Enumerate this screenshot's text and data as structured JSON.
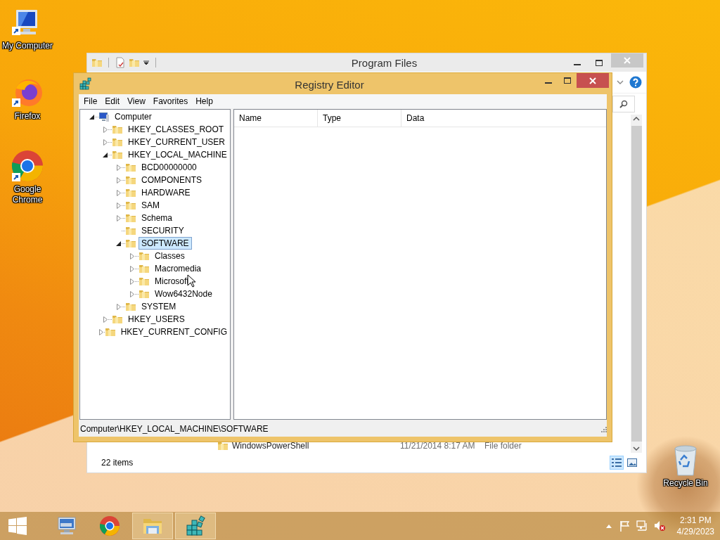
{
  "desktop_icons": [
    {
      "kind": "computer",
      "label": "My Computer"
    },
    {
      "kind": "firefox",
      "label": "Firefox"
    },
    {
      "kind": "chrome",
      "label": "Google Chrome"
    },
    {
      "kind": "recycle-bin",
      "label": "Recycle Bin"
    }
  ],
  "explorer": {
    "title": "Program Files",
    "rows": [
      {
        "name": "WindowsPowerShell",
        "date_modified": "11/21/2014 8:17 AM",
        "type": "File folder"
      }
    ],
    "status": "22 items"
  },
  "registry_editor": {
    "title": "Registry Editor",
    "menu": [
      "File",
      "Edit",
      "View",
      "Favorites",
      "Help"
    ],
    "tree": [
      {
        "label": "Computer",
        "kind": "computer",
        "expandable": true,
        "expanded": true,
        "selected": false,
        "children": [
          {
            "label": "HKEY_CLASSES_ROOT",
            "kind": "folder",
            "expandable": true,
            "expanded": false,
            "selected": false
          },
          {
            "label": "HKEY_CURRENT_USER",
            "kind": "folder",
            "expandable": true,
            "expanded": false,
            "selected": false
          },
          {
            "label": "HKEY_LOCAL_MACHINE",
            "kind": "folder",
            "expandable": true,
            "expanded": true,
            "selected": false,
            "children": [
              {
                "label": "BCD00000000",
                "kind": "folder",
                "expandable": true,
                "expanded": false,
                "selected": false
              },
              {
                "label": "COMPONENTS",
                "kind": "folder",
                "expandable": true,
                "expanded": false,
                "selected": false
              },
              {
                "label": "HARDWARE",
                "kind": "folder",
                "expandable": true,
                "expanded": false,
                "selected": false
              },
              {
                "label": "SAM",
                "kind": "folder",
                "expandable": true,
                "expanded": false,
                "selected": false
              },
              {
                "label": "Schema",
                "kind": "folder",
                "expandable": true,
                "expanded": false,
                "selected": false
              },
              {
                "label": "SECURITY",
                "kind": "folder",
                "expandable": false,
                "expanded": false,
                "selected": false
              },
              {
                "label": "SOFTWARE",
                "kind": "folder",
                "expandable": true,
                "expanded": true,
                "selected": true,
                "children": [
                  {
                    "label": "Classes",
                    "kind": "folder",
                    "expandable": true,
                    "expanded": false,
                    "selected": false
                  },
                  {
                    "label": "Macromedia",
                    "kind": "folder",
                    "expandable": true,
                    "expanded": false,
                    "selected": false
                  },
                  {
                    "label": "Microsoft",
                    "kind": "folder",
                    "expandable": true,
                    "expanded": false,
                    "selected": false
                  },
                  {
                    "label": "Wow6432Node",
                    "kind": "folder",
                    "expandable": true,
                    "expanded": false,
                    "selected": false
                  }
                ]
              },
              {
                "label": "SYSTEM",
                "kind": "folder",
                "expandable": true,
                "expanded": false,
                "selected": false
              }
            ]
          },
          {
            "label": "HKEY_USERS",
            "kind": "folder",
            "expandable": true,
            "expanded": false,
            "selected": false
          },
          {
            "label": "HKEY_CURRENT_CONFIG",
            "kind": "folder",
            "expandable": true,
            "expanded": false,
            "selected": false
          }
        ]
      }
    ],
    "columns": [
      "Name",
      "Type",
      "Data"
    ],
    "status_bar": "Computer\\HKEY_LOCAL_MACHINE\\SOFTWARE"
  },
  "taskbar": {
    "items": [
      {
        "kind": "remote-desktop",
        "running": false
      },
      {
        "kind": "chrome",
        "running": false
      },
      {
        "kind": "file-explorer",
        "running": true
      },
      {
        "kind": "registry",
        "running": true
      }
    ],
    "time": "2:31 PM",
    "date": "4/29/2023"
  }
}
